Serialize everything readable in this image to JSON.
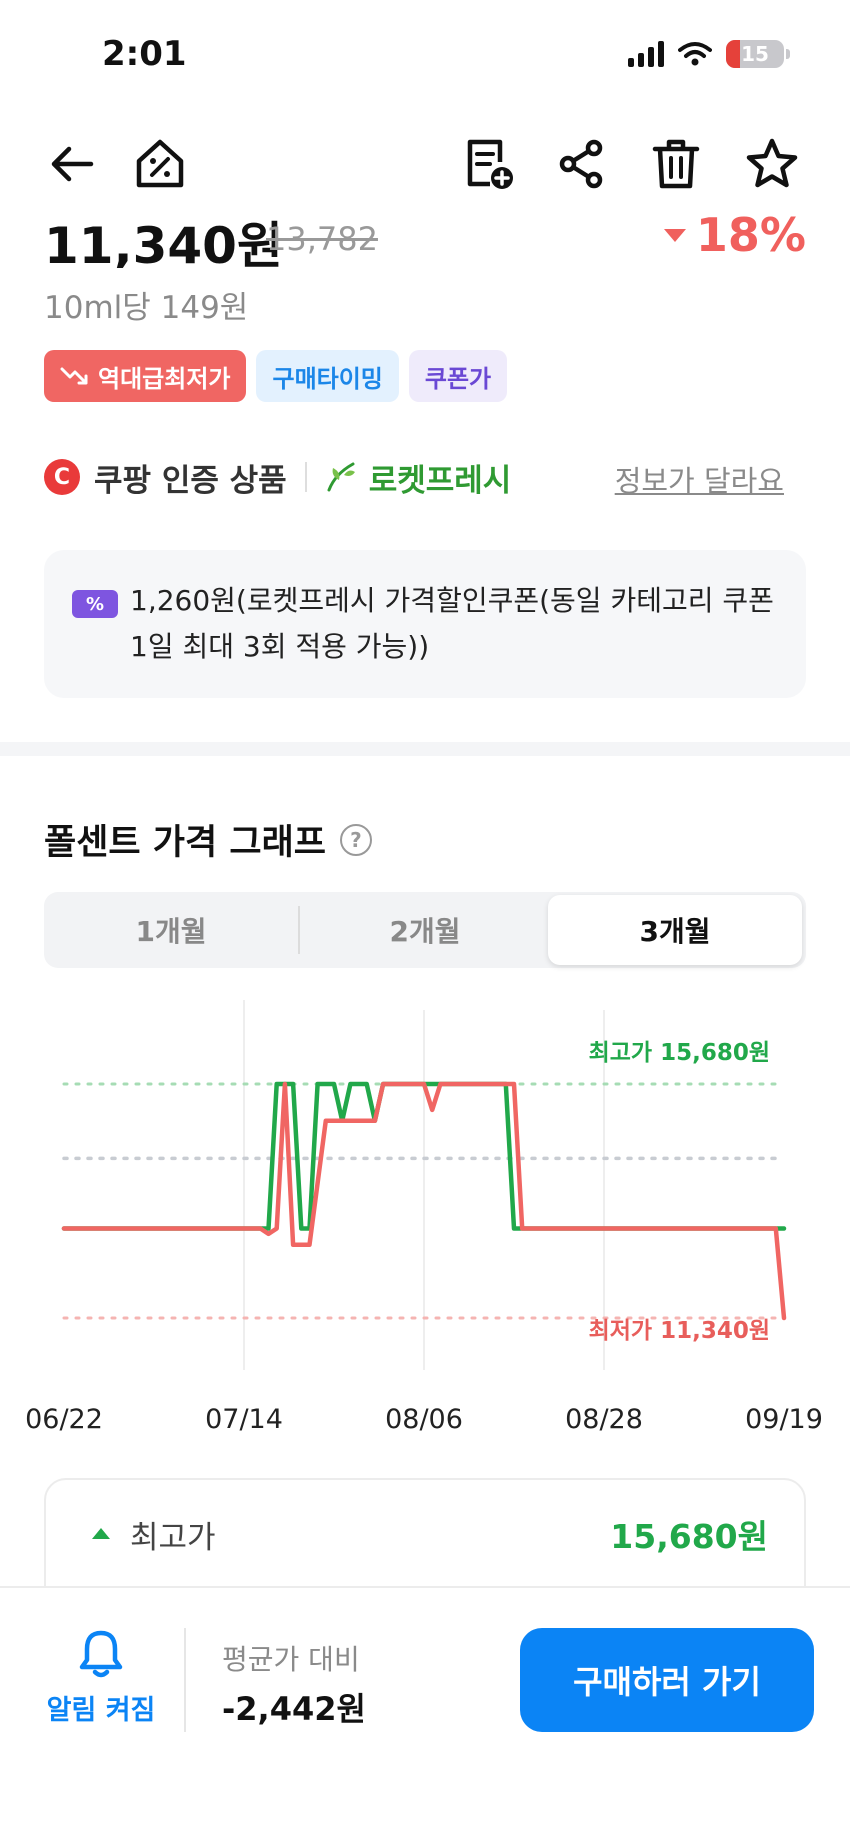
{
  "status_bar": {
    "time": "2:01",
    "battery": "15"
  },
  "product": {
    "price": "11,340원",
    "original_price": "13,782",
    "discount": "18%",
    "unit_price": "10ml당 149원",
    "badges": [
      "역대급최저가",
      "구매타이밍",
      "쿠폰가"
    ],
    "certified": "쿠팡 인증 상품",
    "delivery": "로켓프레시",
    "wrong_info": "정보가 달라요"
  },
  "coupon": {
    "icon": "%",
    "text": "1,260원(로켓프레시 가격할인쿠폰(동일 카테고리 쿠폰 1일 최대 3회 적용 가능))"
  },
  "graph": {
    "title": "폴센트 가격 그래프",
    "help": "?",
    "tabs": [
      "1개월",
      "2개월",
      "3개월"
    ],
    "active_tab": 2
  },
  "chart_data": {
    "type": "line",
    "x_labels": [
      "06/22",
      "07/14",
      "08/06",
      "08/28",
      "09/19"
    ],
    "annotations": {
      "max": "최고가 15,680원",
      "min": "최저가 11,340원"
    },
    "ylim": [
      11340,
      15680
    ],
    "series": [
      {
        "color": "#21a84a",
        "values": [
          [
            0,
            13000
          ],
          [
            24,
            13000
          ],
          [
            25,
            13000
          ],
          [
            26,
            15680
          ],
          [
            28,
            15680
          ],
          [
            29,
            13000
          ],
          [
            30,
            13000
          ],
          [
            31,
            15680
          ],
          [
            33,
            15680
          ],
          [
            34,
            15000
          ],
          [
            35,
            15680
          ],
          [
            37,
            15680
          ],
          [
            38,
            15000
          ],
          [
            39,
            15680
          ],
          [
            54,
            15680
          ],
          [
            55,
            13000
          ],
          [
            88,
            13000
          ]
        ]
      },
      {
        "color": "#f06663",
        "values": [
          [
            0,
            13000
          ],
          [
            24,
            13000
          ],
          [
            25,
            12900
          ],
          [
            26,
            13000
          ],
          [
            27,
            15680
          ],
          [
            28,
            12700
          ],
          [
            30,
            12700
          ],
          [
            32,
            15000
          ],
          [
            38,
            15000
          ],
          [
            39,
            15680
          ],
          [
            44,
            15680
          ],
          [
            45,
            15200
          ],
          [
            46,
            15680
          ],
          [
            55,
            15680
          ],
          [
            56,
            13000
          ],
          [
            87,
            13000
          ],
          [
            88,
            11340
          ]
        ]
      }
    ]
  },
  "stats": {
    "max_label": "최고가",
    "max_value": "15,680원"
  },
  "bottom_bar": {
    "alert_label": "알림 켜짐",
    "avg_label": "평균가 대비",
    "avg_value": "-2,442원",
    "buy_label": "구매하러 가기"
  },
  "colors": {
    "accent": "#0b84f5",
    "up": "#21a84a",
    "down": "#f06663"
  }
}
